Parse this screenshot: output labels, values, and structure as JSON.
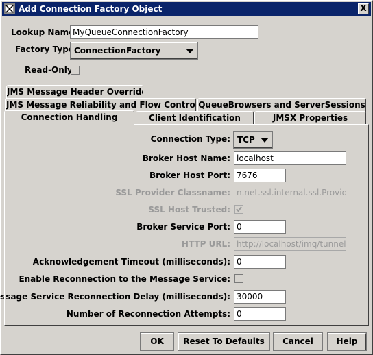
{
  "window": {
    "title": "Add Connection Factory Object",
    "close_label": "X"
  },
  "form": {
    "lookup_name_label": "Lookup Name:",
    "lookup_name_value": "MyQueueConnectionFactory",
    "factory_type_label": "Factory Type:",
    "factory_type_value": "ConnectionFactory",
    "read_only_label": "Read-Only:",
    "read_only_checked": false
  },
  "tabs": {
    "row1": [
      "JMS Message Header Overrides"
    ],
    "row2": [
      "JMS Message Reliability and Flow Controls",
      "QueueBrowsers and ServerSessions"
    ],
    "row3": [
      "Connection Handling",
      "Client Identification",
      "JMSX Properties"
    ],
    "selected": "Connection Handling"
  },
  "connection_handling": {
    "connection_type_label": "Connection Type:",
    "connection_type_value": "TCP",
    "broker_host_name_label": "Broker Host Name:",
    "broker_host_name_value": "localhost",
    "broker_host_port_label": "Broker Host Port:",
    "broker_host_port_value": "7676",
    "ssl_provider_label": "SSL Provider Classname:",
    "ssl_provider_value": "n.net.ssl.internal.ssl.Provider",
    "ssl_host_trusted_label": "SSL Host Trusted:",
    "ssl_host_trusted_checked": true,
    "broker_service_port_label": "Broker Service Port:",
    "broker_service_port_value": "0",
    "http_url_label": "HTTP URL:",
    "http_url_value": "http://localhost/imq/tunnel",
    "ack_timeout_label": "Acknowledgement Timeout (milliseconds):",
    "ack_timeout_value": "0",
    "enable_reconnect_label": "Enable Reconnection to the Message Service:",
    "enable_reconnect_checked": false,
    "reconnect_delay_label": "Message Service Reconnection Delay (milliseconds):",
    "reconnect_delay_value": "30000",
    "reconnect_attempts_label": "Number of Reconnection Attempts:",
    "reconnect_attempts_value": "0"
  },
  "buttons": {
    "ok": "OK",
    "reset": "Reset To Defaults",
    "cancel": "Cancel",
    "help": "Help"
  },
  "colors": {
    "title_bar": "#0a246a",
    "dialog_bg": "#d6d3ce",
    "disabled_text": "#9a9a9a"
  }
}
